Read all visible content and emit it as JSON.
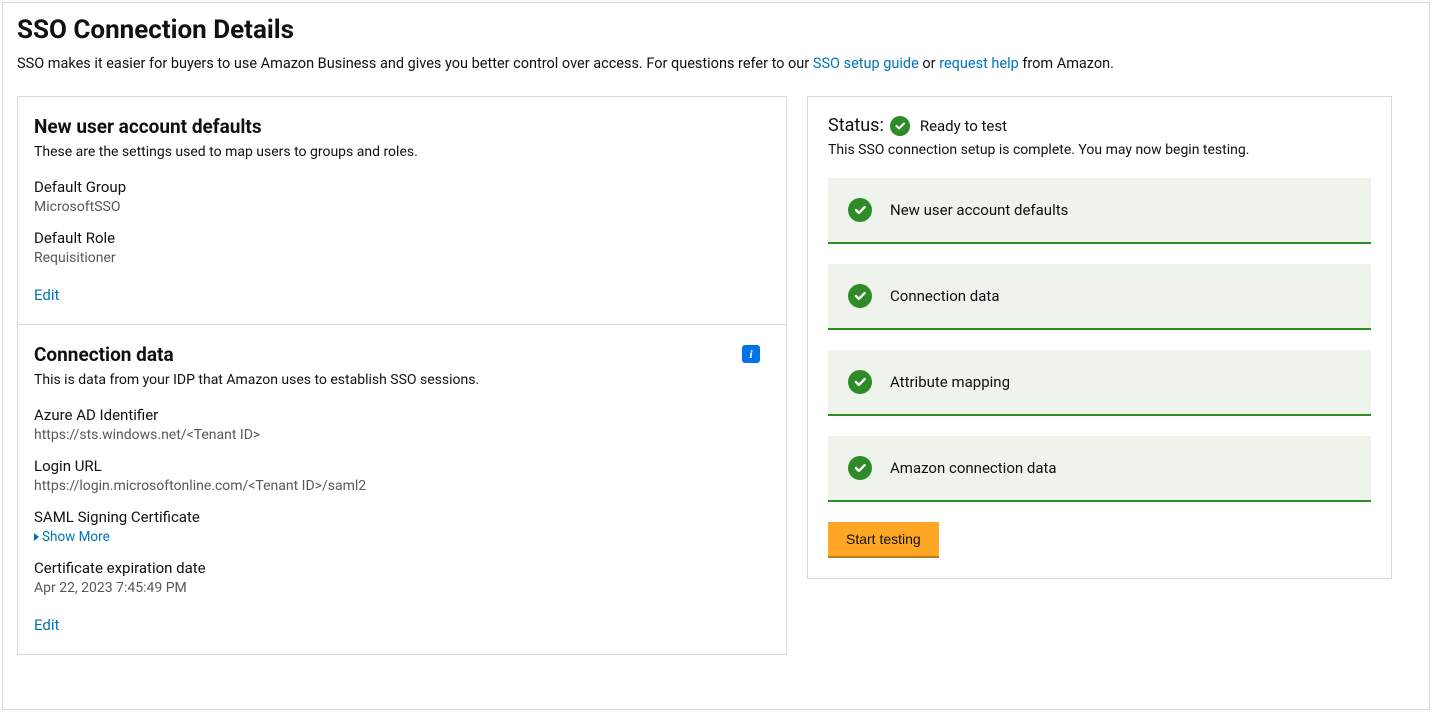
{
  "header": {
    "title": "SSO Connection Details",
    "desc_prefix": "SSO makes it easier for buyers to use Amazon Business and gives you better control over access. For questions refer to our ",
    "link_guide": "SSO setup guide",
    "desc_mid": " or ",
    "link_help": "request help",
    "desc_suffix": " from Amazon."
  },
  "defaults_card": {
    "title": "New user account defaults",
    "subtitle": "These are the settings used to map users to groups and roles.",
    "group_label": "Default Group",
    "group_value": "MicrosoftSSO",
    "role_label": "Default Role",
    "role_value": "Requisitioner",
    "edit": "Edit"
  },
  "connection_card": {
    "title": "Connection data",
    "subtitle": "This is data from your IDP that Amazon uses to establish SSO sessions.",
    "azure_id_label": "Azure AD Identifier",
    "azure_id_value": "https://sts.windows.net/<Tenant ID>",
    "login_url_label": "Login URL",
    "login_url_value": "https://login.microsoftonline.com/<Tenant ID>/saml2",
    "cert_label": "SAML Signing Certificate",
    "show_more": "Show More",
    "cert_exp_label": "Certificate expiration date",
    "cert_exp_value": "Apr 22, 2023 7:45:49 PM",
    "edit": "Edit"
  },
  "status": {
    "prefix": "Status:",
    "label": "Ready to test",
    "desc": "This SSO connection setup is complete. You may now begin testing.",
    "items": [
      "New user account defaults",
      "Connection data",
      "Attribute mapping",
      "Amazon connection data"
    ],
    "start_button": "Start testing"
  }
}
